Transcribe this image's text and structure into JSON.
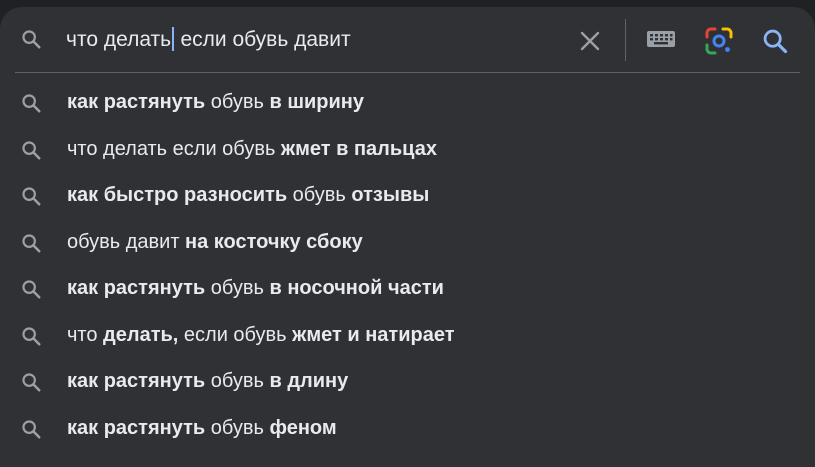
{
  "search": {
    "query_before_caret": "что делать",
    "query_after_caret": " если обувь давит"
  },
  "icons": {
    "search": "search-icon",
    "clear": "close-icon",
    "keyboard": "keyboard-icon",
    "lens": "google-lens-icon",
    "submit": "search-icon"
  },
  "colors": {
    "background": "#303134",
    "text": "#e8eaed",
    "icon": "#9aa0a6",
    "caret": "#8ab4f8",
    "search_button": "#8ab4f8",
    "lens_blue": "#4285f4",
    "lens_red": "#ea4335",
    "lens_yellow": "#fbbc04",
    "lens_green": "#34a853"
  },
  "suggestions": [
    {
      "segments": [
        {
          "text": "как растянуть",
          "bold": true
        },
        {
          "text": " обувь ",
          "bold": false
        },
        {
          "text": "в ширину",
          "bold": true
        }
      ]
    },
    {
      "segments": [
        {
          "text": "что делать если обувь ",
          "bold": false
        },
        {
          "text": "жмет в пальцах",
          "bold": true
        }
      ]
    },
    {
      "segments": [
        {
          "text": "как быстро разносить",
          "bold": true
        },
        {
          "text": " обувь ",
          "bold": false
        },
        {
          "text": "отзывы",
          "bold": true
        }
      ]
    },
    {
      "segments": [
        {
          "text": "обувь давит ",
          "bold": false
        },
        {
          "text": "на косточку сбоку",
          "bold": true
        }
      ]
    },
    {
      "segments": [
        {
          "text": "как растянуть",
          "bold": true
        },
        {
          "text": " обувь ",
          "bold": false
        },
        {
          "text": "в носочной части",
          "bold": true
        }
      ]
    },
    {
      "segments": [
        {
          "text": "что ",
          "bold": false
        },
        {
          "text": "делать,",
          "bold": true
        },
        {
          "text": " если обувь ",
          "bold": false
        },
        {
          "text": "жмет и натирает",
          "bold": true
        }
      ]
    },
    {
      "segments": [
        {
          "text": "как растянуть",
          "bold": true
        },
        {
          "text": " обувь ",
          "bold": false
        },
        {
          "text": "в длину",
          "bold": true
        }
      ]
    },
    {
      "segments": [
        {
          "text": "как растянуть",
          "bold": true
        },
        {
          "text": " обувь ",
          "bold": false
        },
        {
          "text": "феном",
          "bold": true
        }
      ]
    }
  ]
}
